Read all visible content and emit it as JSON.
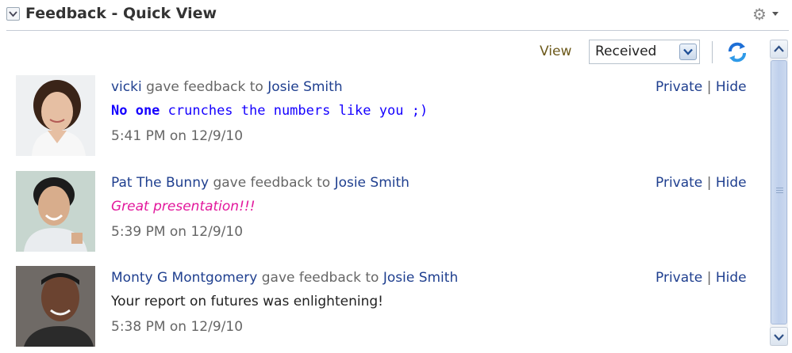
{
  "header": {
    "title": "Feedback - Quick View"
  },
  "toolbar": {
    "view_label": "View",
    "view_selected": "Received"
  },
  "feed": [
    {
      "from": "vicki",
      "verb": "gave feedback to",
      "to": "Josie Smith",
      "message_strong": "No one",
      "message_rest": " crunches the numbers like you ;)",
      "time": "5:41 PM on 12/9/10",
      "private_label": "Private",
      "separator": "|",
      "hide_label": "Hide"
    },
    {
      "from": "Pat The Bunny",
      "verb": "gave feedback to",
      "to": "Josie Smith",
      "message": "Great presentation!!!",
      "time": "5:39 PM on 12/9/10",
      "private_label": "Private",
      "separator": "|",
      "hide_label": "Hide"
    },
    {
      "from": "Monty G Montgomery",
      "verb": "gave feedback to",
      "to": "Josie Smith",
      "message": "Your report on futures was enlightening!",
      "time": "5:38 PM on 12/9/10",
      "private_label": "Private",
      "separator": "|",
      "hide_label": "Hide"
    }
  ],
  "icons": {
    "collapse": "chevron-down-icon",
    "settings": "gear-icon",
    "refresh": "refresh-icon"
  },
  "colors": {
    "link": "#1f3f8f",
    "mono_message": "#1500ff",
    "pink_message": "#e2179c",
    "view_label": "#6d5a1c"
  }
}
